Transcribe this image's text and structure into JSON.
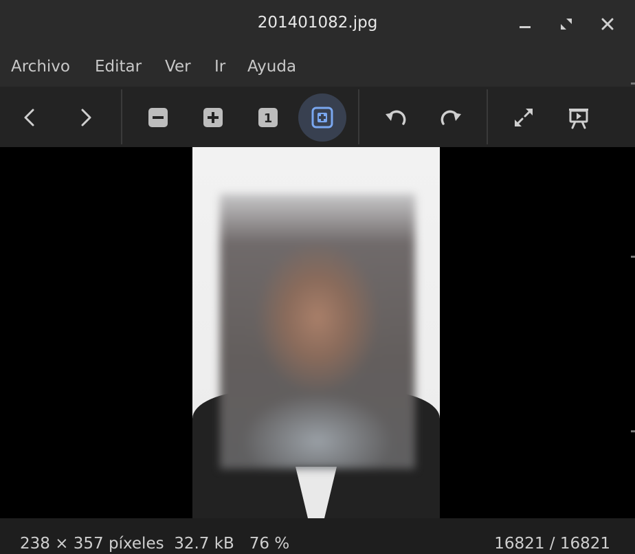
{
  "window": {
    "title": "201401082.jpg",
    "controls": [
      "minimize-icon",
      "restore-icon",
      "close-icon"
    ]
  },
  "menubar": {
    "items": [
      {
        "label": "Archivo"
      },
      {
        "label": "Editar"
      },
      {
        "label": "Ver"
      },
      {
        "label": "Ir"
      },
      {
        "label": "Ayuda"
      }
    ]
  },
  "toolbar": {
    "buttons": [
      {
        "icon": "previous-icon"
      },
      {
        "icon": "next-icon"
      },
      {
        "icon": "zoom-out-icon"
      },
      {
        "icon": "zoom-in-icon"
      },
      {
        "icon": "zoom-1-1-icon",
        "glyph": "1"
      },
      {
        "icon": "zoom-fit-icon",
        "active": true
      },
      {
        "icon": "rotate-left-icon"
      },
      {
        "icon": "rotate-right-icon"
      },
      {
        "icon": "fullscreen-icon"
      },
      {
        "icon": "slideshow-icon"
      }
    ],
    "accent": "#7aa7f0"
  },
  "status": {
    "dimensions": "238 × 357 píxeles",
    "size": "32.7 kB",
    "zoom": "76 %",
    "position": "16821 / 16821"
  }
}
